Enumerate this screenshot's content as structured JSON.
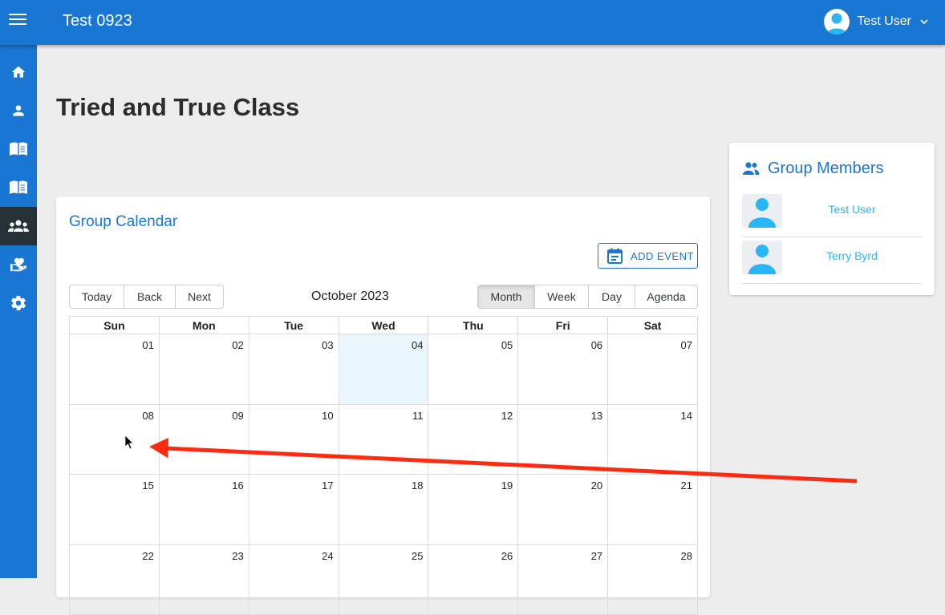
{
  "app": {
    "title": "Test 0923"
  },
  "user": {
    "name": "Test User"
  },
  "sidebar": {
    "items": [
      {
        "icon": "home-icon",
        "active": false
      },
      {
        "icon": "person-icon",
        "active": false
      },
      {
        "icon": "book-icon",
        "active": false
      },
      {
        "icon": "book-icon",
        "active": false
      },
      {
        "icon": "groups-icon",
        "active": true
      },
      {
        "icon": "volunteer-icon",
        "active": false
      },
      {
        "icon": "gear-icon",
        "active": false
      }
    ]
  },
  "page": {
    "title": "Tried and True Class"
  },
  "calendar": {
    "title": "Group Calendar",
    "add_event_label": "ADD EVENT",
    "nav": [
      "Today",
      "Back",
      "Next"
    ],
    "label": "October 2023",
    "views": [
      "Month",
      "Week",
      "Day",
      "Agenda"
    ],
    "selected_view": "Month",
    "weekdays": [
      "Sun",
      "Mon",
      "Tue",
      "Wed",
      "Thu",
      "Fri",
      "Sat"
    ],
    "weeks": [
      [
        "01",
        "02",
        "03",
        "04",
        "05",
        "06",
        "07"
      ],
      [
        "08",
        "09",
        "10",
        "11",
        "12",
        "13",
        "14"
      ],
      [
        "15",
        "16",
        "17",
        "18",
        "19",
        "20",
        "21"
      ],
      [
        "22",
        "23",
        "24",
        "25",
        "26",
        "27",
        "28"
      ]
    ],
    "today": "04"
  },
  "members": {
    "title": "Group Members",
    "list": [
      {
        "name": "Test User"
      },
      {
        "name": "Terry Byrd"
      }
    ]
  },
  "colors": {
    "primary": "#1976d2",
    "today_bg": "#eaf6ff",
    "member_link": "#29b6f6",
    "annotation_arrow": "#ff2a10"
  }
}
